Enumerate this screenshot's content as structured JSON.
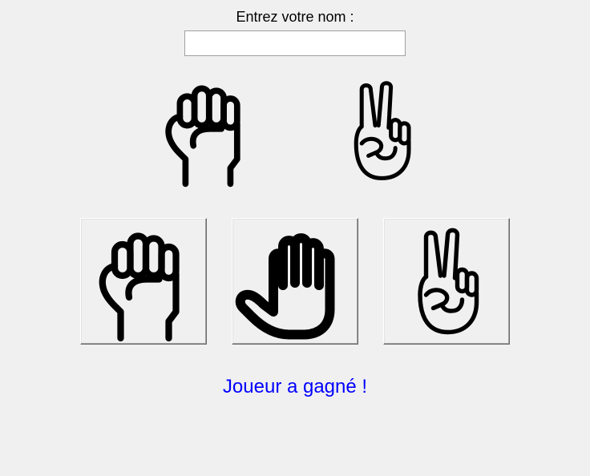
{
  "name_prompt": "Entrez votre nom :",
  "name_input": {
    "value": "",
    "placeholder": ""
  },
  "display": {
    "player_hand": "rock",
    "computer_hand": "scissors"
  },
  "choices": [
    {
      "id": "rock",
      "icon": "rock-hand-icon"
    },
    {
      "id": "paper",
      "icon": "paper-hand-icon"
    },
    {
      "id": "scissors",
      "icon": "scissors-hand-icon"
    }
  ],
  "result": {
    "text": "Joueur a gagné !",
    "color": "#0000ff"
  },
  "colors": {
    "background": "#f0f0f0",
    "icon_stroke": "#000000"
  }
}
